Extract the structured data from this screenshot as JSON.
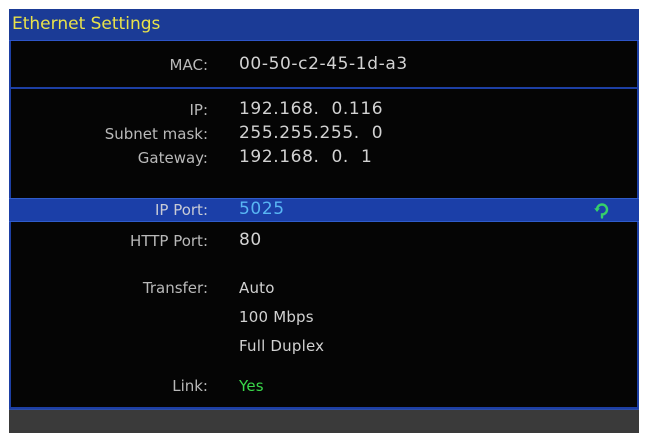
{
  "window": {
    "title": "Ethernet Settings"
  },
  "fields": {
    "mac": {
      "label": "MAC:",
      "value": "00-50-c2-45-1d-a3"
    },
    "ip": {
      "label": "IP:",
      "value": "192.168.  0.116"
    },
    "subnet": {
      "label": "Subnet mask:",
      "value": "255.255.255.  0"
    },
    "gateway": {
      "label": "Gateway:",
      "value": "192.168.  0.  1"
    },
    "ip_port": {
      "label": "IP Port:",
      "value": "5025",
      "selected": true
    },
    "http_port": {
      "label": "HTTP Port:",
      "value": "80"
    },
    "transfer": {
      "label": "Transfer:",
      "values": [
        "Auto",
        "100 Mbps",
        "Full Duplex"
      ]
    },
    "link": {
      "label": "Link:",
      "value": "Yes"
    }
  },
  "icons": {
    "reset": "refresh-icon"
  },
  "colors": {
    "title_bar": "#1b3b96",
    "title_text": "#e9e24a",
    "selection": "#1b3fa8",
    "selected_value": "#58b6f4",
    "link_ok": "#39d84a",
    "refresh_icon": "#36d06a"
  }
}
